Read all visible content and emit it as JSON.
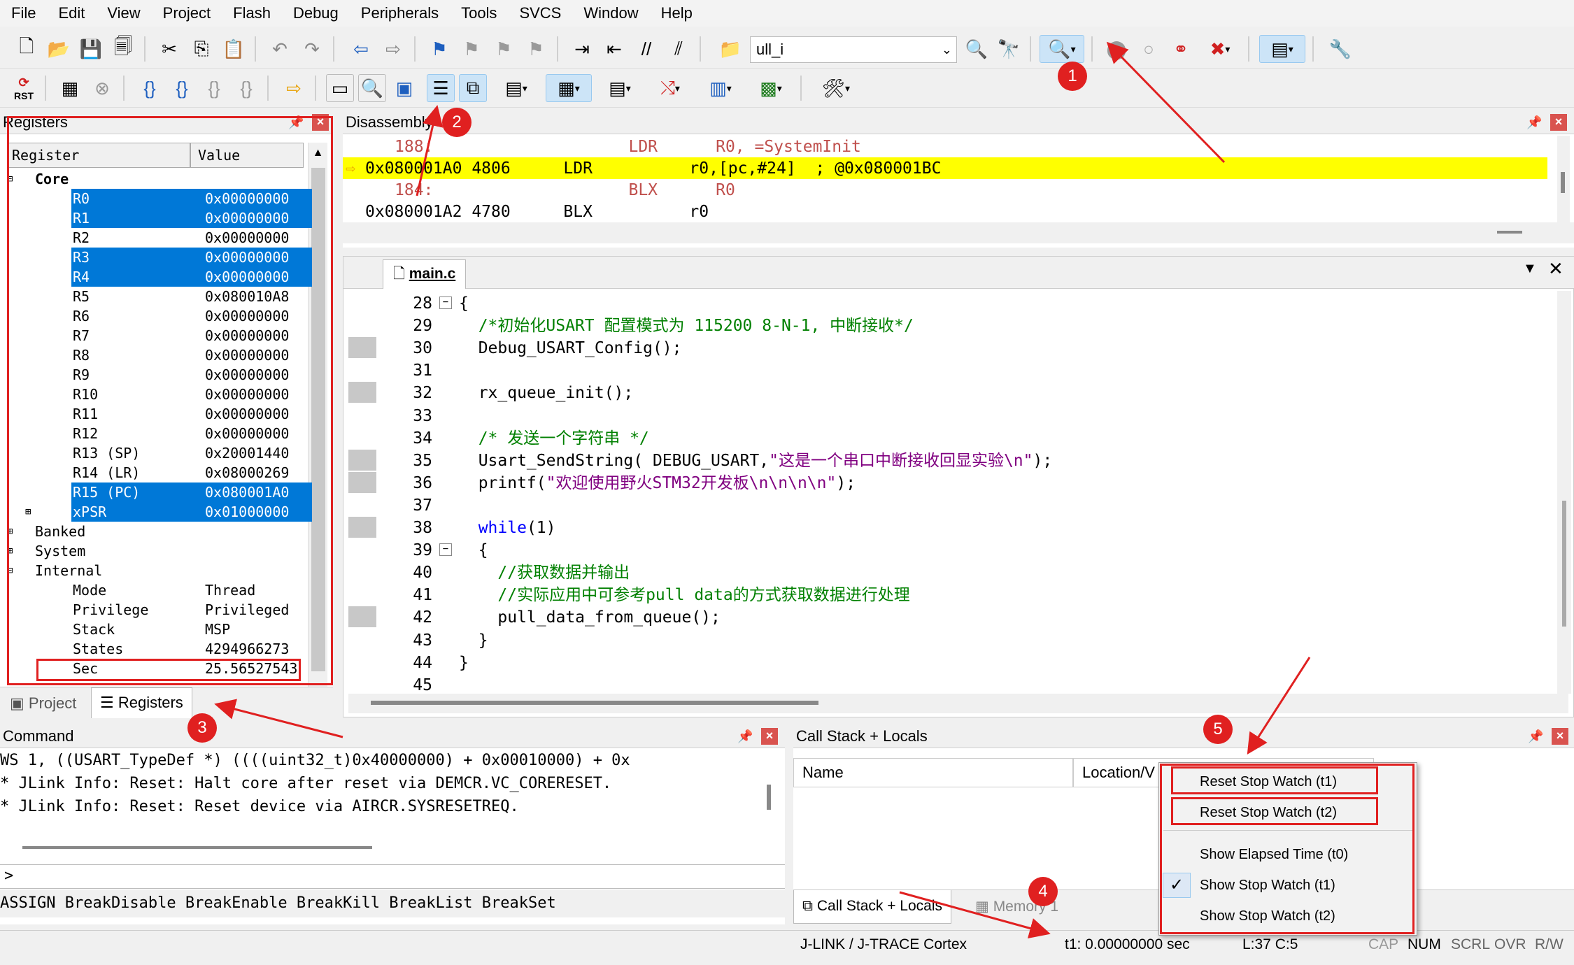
{
  "menu": [
    "File",
    "Edit",
    "View",
    "Project",
    "Flash",
    "Debug",
    "Peripherals",
    "Tools",
    "SVCS",
    "Window",
    "Help"
  ],
  "toolbar": {
    "find_text": "ull_i",
    "rst_label": "RST"
  },
  "registers_panel": {
    "title": "Registers",
    "col_register": "Register",
    "col_value": "Value",
    "core_label": "Core",
    "rows": [
      {
        "name": "R0",
        "value": "0x00000000",
        "selected": true
      },
      {
        "name": "R1",
        "value": "0x00000000",
        "selected": true
      },
      {
        "name": "R2",
        "value": "0x00000000",
        "selected": false
      },
      {
        "name": "R3",
        "value": "0x00000000",
        "selected": true
      },
      {
        "name": "R4",
        "value": "0x00000000",
        "selected": true
      },
      {
        "name": "R5",
        "value": "0x080010A8",
        "selected": false
      },
      {
        "name": "R6",
        "value": "0x00000000",
        "selected": false
      },
      {
        "name": "R7",
        "value": "0x00000000",
        "selected": false
      },
      {
        "name": "R8",
        "value": "0x00000000",
        "selected": false
      },
      {
        "name": "R9",
        "value": "0x00000000",
        "selected": false
      },
      {
        "name": "R10",
        "value": "0x00000000",
        "selected": false
      },
      {
        "name": "R11",
        "value": "0x00000000",
        "selected": false
      },
      {
        "name": "R12",
        "value": "0x00000000",
        "selected": false
      },
      {
        "name": "R13 (SP)",
        "value": "0x20001440",
        "selected": false
      },
      {
        "name": "R14 (LR)",
        "value": "0x08000269",
        "selected": false
      },
      {
        "name": "R15 (PC)",
        "value": "0x080001A0",
        "selected": true
      },
      {
        "name": "xPSR",
        "value": "0x01000000",
        "selected": true
      }
    ],
    "groups": [
      "Banked",
      "System",
      "Internal"
    ],
    "internal_rows": [
      {
        "name": "Mode",
        "value": "Thread"
      },
      {
        "name": "Privilege",
        "value": "Privileged"
      },
      {
        "name": "Stack",
        "value": "MSP"
      },
      {
        "name": "States",
        "value": "4294966273"
      },
      {
        "name": "Sec",
        "value": "25.56527543"
      }
    ],
    "tab_project": "Project",
    "tab_registers": "Registers"
  },
  "disassembly": {
    "title": "Disassembly",
    "lines": [
      {
        "addr": "188:",
        "code": "          LDR      R0, =SystemInit",
        "current": false,
        "src": true
      },
      {
        "addr": "0x080001A0 4806",
        "code": "    LDR          r0,[pc,#24]  ; @0x080001BC",
        "current": true,
        "src": false
      },
      {
        "addr": "184:",
        "code": "          BLX      R0",
        "current": false,
        "src": true
      },
      {
        "addr": "0x080001A2 4780",
        "code": "    BLX          r0",
        "current": false,
        "src": false
      }
    ]
  },
  "editor": {
    "tab": "main.c",
    "lines": [
      {
        "n": "28",
        "code": "{"
      },
      {
        "n": "29",
        "code": "  /*初始化USART 配置模式为 115200 8-N-1, 中断接收*/"
      },
      {
        "n": "30",
        "code": "  Debug_USART_Config();"
      },
      {
        "n": "31",
        "code": ""
      },
      {
        "n": "32",
        "code": "  rx_queue_init();"
      },
      {
        "n": "33",
        "code": ""
      },
      {
        "n": "34",
        "code": "  /* 发送一个字符串 */"
      },
      {
        "n": "35",
        "code": "  Usart_SendString( DEBUG_USART,\"这是一个串口中断接收回显实验\\n\");"
      },
      {
        "n": "36",
        "code": "  printf(\"欢迎使用野火STM32开发板\\n\\n\\n\\n\");"
      },
      {
        "n": "37",
        "code": ""
      },
      {
        "n": "38",
        "code": "  while(1)"
      },
      {
        "n": "39",
        "code": "  {"
      },
      {
        "n": "40",
        "code": "    //获取数据并输出"
      },
      {
        "n": "41",
        "code": "    //实际应用中可参考pull data的方式获取数据进行处理"
      },
      {
        "n": "42",
        "code": "    pull_data_from_queue();"
      },
      {
        "n": "43",
        "code": "  }"
      },
      {
        "n": "44",
        "code": "}"
      },
      {
        "n": "45",
        "code": ""
      }
    ]
  },
  "command": {
    "title": "Command",
    "lines": [
      "WS 1, ((USART_TypeDef *) ((((uint32_t)0x40000000) + 0x00010000) + 0x",
      "* JLink Info: Reset: Halt core after reset via DEMCR.VC_CORERESET.",
      "* JLink Info: Reset: Reset device via AIRCR.SYSRESETREQ."
    ],
    "prompt": ">",
    "hints": "ASSIGN BreakDisable BreakEnable BreakKill BreakList BreakSet"
  },
  "callstack": {
    "title": "Call Stack + Locals",
    "col_name": "Name",
    "col_location": "Location/V",
    "tab_callstack": "Call Stack + Locals",
    "tab_memory": "Memory 1"
  },
  "context_menu": {
    "items": [
      {
        "label": "Reset Stop Watch (t1)",
        "checked": false
      },
      {
        "label": "Reset Stop Watch (t2)",
        "checked": false
      },
      {
        "label": "Show Elapsed Time (t0)",
        "checked": false
      },
      {
        "label": "Show Stop Watch (t1)",
        "checked": true
      },
      {
        "label": "Show Stop Watch (t2)",
        "checked": false
      }
    ]
  },
  "statusbar": {
    "debugger": "J-LINK / J-TRACE Cortex",
    "timer": "t1: 0.00000000 sec",
    "position": "L:37 C:5",
    "caps": "CAP",
    "num": "NUM",
    "scrl": "SCRL",
    "ovr": "OVR",
    "rw": "R/W"
  },
  "badges": [
    "1",
    "2",
    "3",
    "4",
    "5"
  ],
  "colors": {
    "accent_red": "#e02020",
    "selection_blue": "#0078d7",
    "current_line": "#ffff00",
    "comment_green": "#008000",
    "string_purple": "#800080",
    "keyword_blue": "#0000ff"
  }
}
